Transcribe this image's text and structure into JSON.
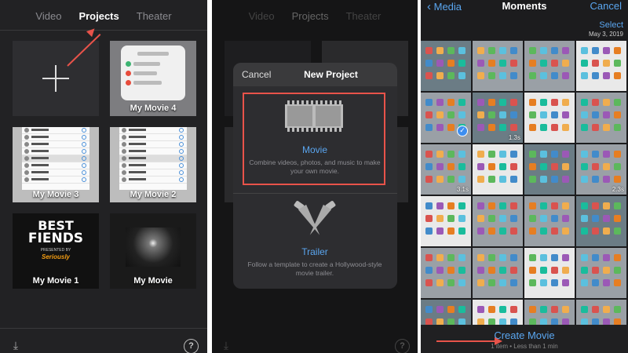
{
  "panel1": {
    "tabs": [
      "Video",
      "Projects",
      "Theater"
    ],
    "projects": [
      {
        "title": "",
        "kind": "new"
      },
      {
        "title": "My Movie 4",
        "kind": "control-center"
      },
      {
        "title": "My Movie 3",
        "kind": "contacts"
      },
      {
        "title": "My Movie 2",
        "kind": "contacts"
      },
      {
        "title": "My Movie 1",
        "kind": "poster"
      },
      {
        "title": "My Movie",
        "kind": "concert"
      }
    ],
    "poster_line1": "BEST",
    "poster_line2": "FIENDS",
    "poster_sub": "PRESENTED BY",
    "poster_brand": "Seriously",
    "contacts": [
      "Jason",
      "Abby",
      "Mom",
      "Home",
      "Adam",
      "Brian V"
    ],
    "help": "?"
  },
  "panel2": {
    "tabs": [
      "Video",
      "Projects",
      "Theater"
    ],
    "modal": {
      "cancel": "Cancel",
      "title": "New Project",
      "movie_label": "Movie",
      "movie_desc": "Combine videos, photos, and music to make your own movie.",
      "trailer_label": "Trailer",
      "trailer_desc": "Follow a template to create a Hollywood-style movie trailer."
    },
    "help": "?"
  },
  "panel3": {
    "back": "Media",
    "title": "Moments",
    "cancel": "Cancel",
    "select": "Select",
    "date": "May 3, 2019",
    "durations": [
      "1.3s",
      "3.1s",
      "2.3s"
    ],
    "create_movie": "Create Movie",
    "create_sub": "1 item • Less than 1 min"
  },
  "colors": {
    "accent_blue": "#5aa6f0",
    "highlight_red": "#e8534a"
  }
}
